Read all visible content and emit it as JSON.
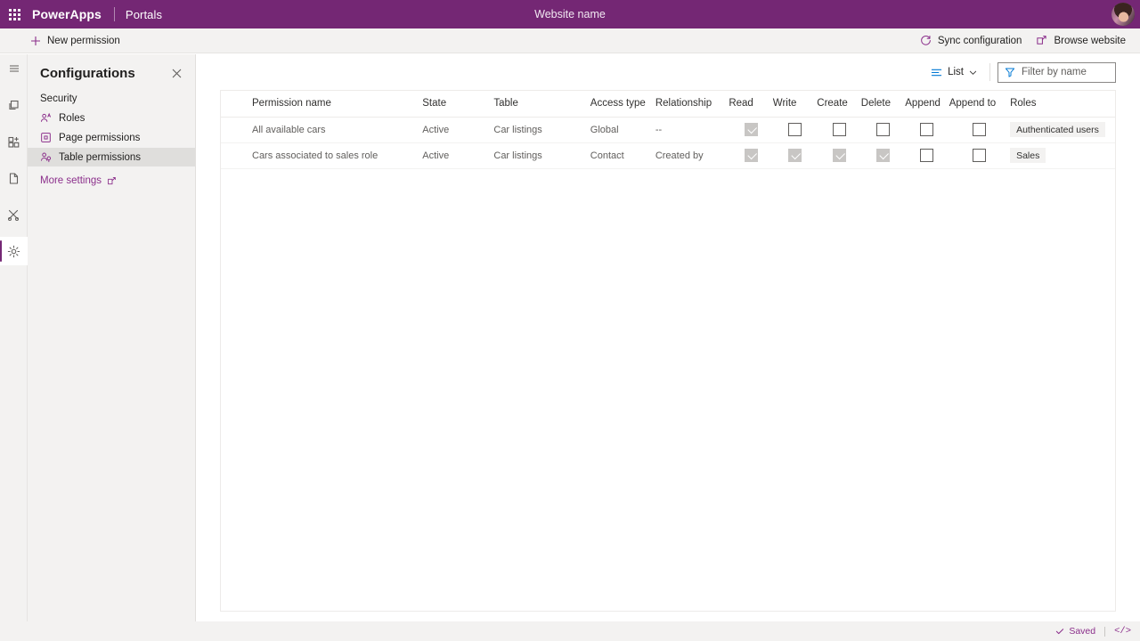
{
  "suite_bar": {
    "waffle_icon": "app-launcher-waffle-icon",
    "brand": "PowerApps",
    "app_name": "Portals",
    "site_title": "Website name",
    "avatar_alt": "user-avatar"
  },
  "command_bar": {
    "new_permission": "New permission",
    "new_icon": "plus-icon",
    "sync_configuration": "Sync configuration",
    "sync_icon": "refresh-icon",
    "browse_website": "Browse website",
    "browse_icon": "open-in-new-window-icon"
  },
  "rail": {
    "items": [
      {
        "name": "menu-icon",
        "selected": false
      },
      {
        "name": "pages-icon",
        "selected": false
      },
      {
        "name": "components-icon",
        "selected": false
      },
      {
        "name": "page-icon",
        "selected": false
      },
      {
        "name": "styling-icon",
        "selected": false
      },
      {
        "name": "settings-gear-icon",
        "selected": true
      }
    ]
  },
  "panel": {
    "title": "Configurations",
    "close_icon": "close-icon",
    "group_label": "Security",
    "items": [
      {
        "label": "Roles",
        "icon": "roles-person-icon",
        "selected": false
      },
      {
        "label": "Page permissions",
        "icon": "page-permissions-icon",
        "selected": false
      },
      {
        "label": "Table permissions",
        "icon": "table-permissions-icon",
        "selected": true
      }
    ],
    "more_settings": "More settings",
    "more_settings_icon": "open-in-new-window-icon"
  },
  "toolbar": {
    "view_label": "List",
    "view_icon": "list-view-icon",
    "chevron_icon": "chevron-down-icon",
    "filter_icon": "filter-funnel-icon",
    "filter_placeholder": "Filter by name",
    "filter_value": ""
  },
  "table": {
    "columns": [
      "Permission name",
      "State",
      "Table",
      "Access type",
      "Relationship",
      "Read",
      "Write",
      "Create",
      "Delete",
      "Append",
      "Append to",
      "Roles"
    ],
    "rows": [
      {
        "permission_name": "All available cars",
        "state": "Active",
        "table": "Car listings",
        "access_type": "Global",
        "relationship": "--",
        "read": true,
        "write": false,
        "create": false,
        "delete": false,
        "append": false,
        "append_to": false,
        "roles": "Authenticated users"
      },
      {
        "permission_name": "Cars associated to sales role",
        "state": "Active",
        "table": "Car listings",
        "access_type": "Contact",
        "relationship": "Created by",
        "read": true,
        "write": true,
        "create": true,
        "delete": true,
        "append": false,
        "append_to": false,
        "roles": "Sales"
      }
    ]
  },
  "status_bar": {
    "saved_label": "Saved",
    "saved_icon": "checkmark-icon",
    "code_icon": "code-brackets-icon",
    "code_label": "</>"
  },
  "colors": {
    "brand_purple": "#742774",
    "link_purple": "#8b2f8b",
    "accent_blue": "#0078d4",
    "checkbox_disabled": "#c8c6c4",
    "panel_bg": "#f3f2f1"
  }
}
